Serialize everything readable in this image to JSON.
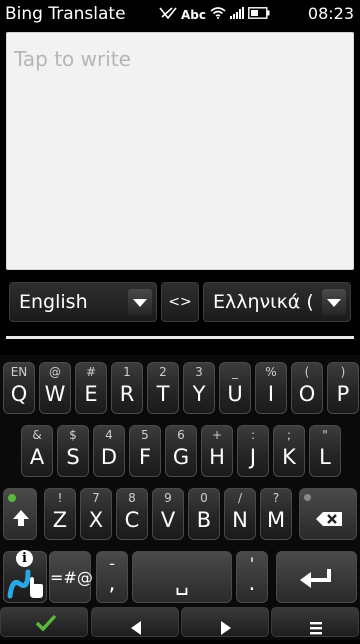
{
  "status_bar": {
    "app_title": "Bing Translate",
    "input_mode": "Abc",
    "time": "08:23"
  },
  "editor": {
    "placeholder": "Tap to write"
  },
  "language_bar": {
    "source_language": "English",
    "swap_label": "<>",
    "target_language": "Ελληνικά ("
  },
  "keyboard": {
    "row1": [
      {
        "main": "Q",
        "sec": "EN"
      },
      {
        "main": "W",
        "sec": "@"
      },
      {
        "main": "E",
        "sec": "#"
      },
      {
        "main": "R",
        "sec": "1"
      },
      {
        "main": "T",
        "sec": "2"
      },
      {
        "main": "Y",
        "sec": "3"
      },
      {
        "main": "U",
        "sec": "_"
      },
      {
        "main": "I",
        "sec": "%"
      },
      {
        "main": "O",
        "sec": "("
      },
      {
        "main": "P",
        "sec": ")"
      }
    ],
    "row2": [
      {
        "main": "A",
        "sec": "&"
      },
      {
        "main": "S",
        "sec": "$"
      },
      {
        "main": "D",
        "sec": "4"
      },
      {
        "main": "F",
        "sec": "5"
      },
      {
        "main": "G",
        "sec": "6"
      },
      {
        "main": "H",
        "sec": "+"
      },
      {
        "main": "J",
        "sec": ":"
      },
      {
        "main": "K",
        "sec": ";"
      },
      {
        "main": "L",
        "sec": "\""
      }
    ],
    "row3": [
      {
        "main": "Z",
        "sec": "!"
      },
      {
        "main": "X",
        "sec": "7"
      },
      {
        "main": "C",
        "sec": "8"
      },
      {
        "main": "V",
        "sec": "9"
      },
      {
        "main": "B",
        "sec": "0"
      },
      {
        "main": "N",
        "sec": "/"
      },
      {
        "main": "M",
        "sec": "?"
      }
    ],
    "symbols_label": "=#@",
    "comma_label": ",",
    "comma_sec": "-",
    "period_label": ".",
    "period_sec": "'",
    "space_label": "␣"
  },
  "softkeys": {
    "left_icon": "checkmark-icon",
    "prev_icon": "left-arrow-icon",
    "next_icon": "right-arrow-icon",
    "menu_icon": "menu-icon"
  },
  "colors": {
    "accent_green": "#5ab83a",
    "handwriting_blue": "#2aa7e6"
  }
}
